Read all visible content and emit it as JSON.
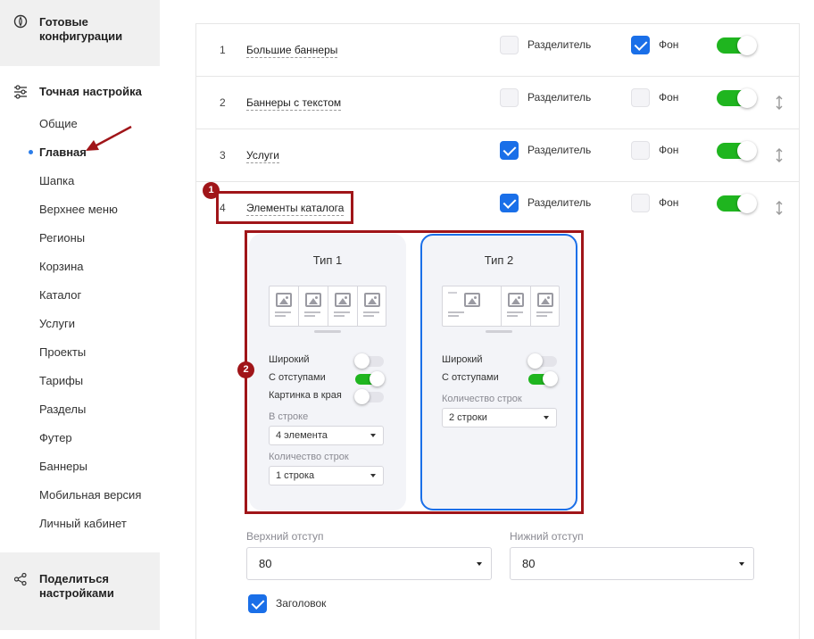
{
  "sidebar": {
    "ready_configs": {
      "label": "Готовые\nконфигурации",
      "icon": "palette-icon"
    },
    "fine_tuning": {
      "label": "Точная настройка",
      "icon": "sliders-icon"
    },
    "items": [
      {
        "label": "Общие"
      },
      {
        "label": "Главная",
        "active": true
      },
      {
        "label": "Шапка"
      },
      {
        "label": "Верхнее меню"
      },
      {
        "label": "Регионы"
      },
      {
        "label": "Корзина"
      },
      {
        "label": "Каталог"
      },
      {
        "label": "Услуги"
      },
      {
        "label": "Проекты"
      },
      {
        "label": "Тарифы"
      },
      {
        "label": "Разделы"
      },
      {
        "label": "Футер"
      },
      {
        "label": "Баннеры"
      },
      {
        "label": "Мобильная версия"
      },
      {
        "label": "Личный кабинет"
      }
    ],
    "share": {
      "label": "Поделиться\nнастройками",
      "icon": "share-icon"
    }
  },
  "rows": [
    {
      "num": "1",
      "name": "Большие баннеры",
      "divider": false,
      "background": true,
      "enabled": true,
      "draggable": false
    },
    {
      "num": "2",
      "name": "Баннеры с текстом",
      "divider": false,
      "background": false,
      "enabled": true,
      "draggable": true
    },
    {
      "num": "3",
      "name": "Услуги",
      "divider": true,
      "background": false,
      "enabled": true,
      "draggable": true
    },
    {
      "num": "4",
      "name": "Элементы каталога",
      "divider": true,
      "background": false,
      "enabled": true,
      "draggable": true
    }
  ],
  "labels": {
    "divider": "Разделитель",
    "background": "Фон"
  },
  "types": [
    {
      "title": "Тип 1",
      "selected": false,
      "options": [
        {
          "label": "Широкий",
          "on": false
        },
        {
          "label": "С отступами",
          "on": true
        },
        {
          "label": "Картинка в края",
          "on": false
        }
      ],
      "per_row_label": "В строке",
      "per_row_value": "4 элемента",
      "rows_label": "Количество строк",
      "rows_value": "1 строка"
    },
    {
      "title": "Тип 2",
      "selected": true,
      "options": [
        {
          "label": "Широкий",
          "on": false
        },
        {
          "label": "С отступами",
          "on": true
        }
      ],
      "rows_label": "Количество строк",
      "rows_value": "2 строки"
    }
  ],
  "spacing": {
    "top_label": "Верхний отступ",
    "top_value": "80",
    "bottom_label": "Нижний отступ",
    "bottom_value": "80"
  },
  "heading": {
    "label": "Заголовок",
    "checked": true
  },
  "annotations": {
    "badge1": "1",
    "badge2": "2"
  },
  "colors": {
    "accent": "#1a6fe8",
    "toggle_on": "#1fb51f",
    "annotation": "#a01519"
  }
}
